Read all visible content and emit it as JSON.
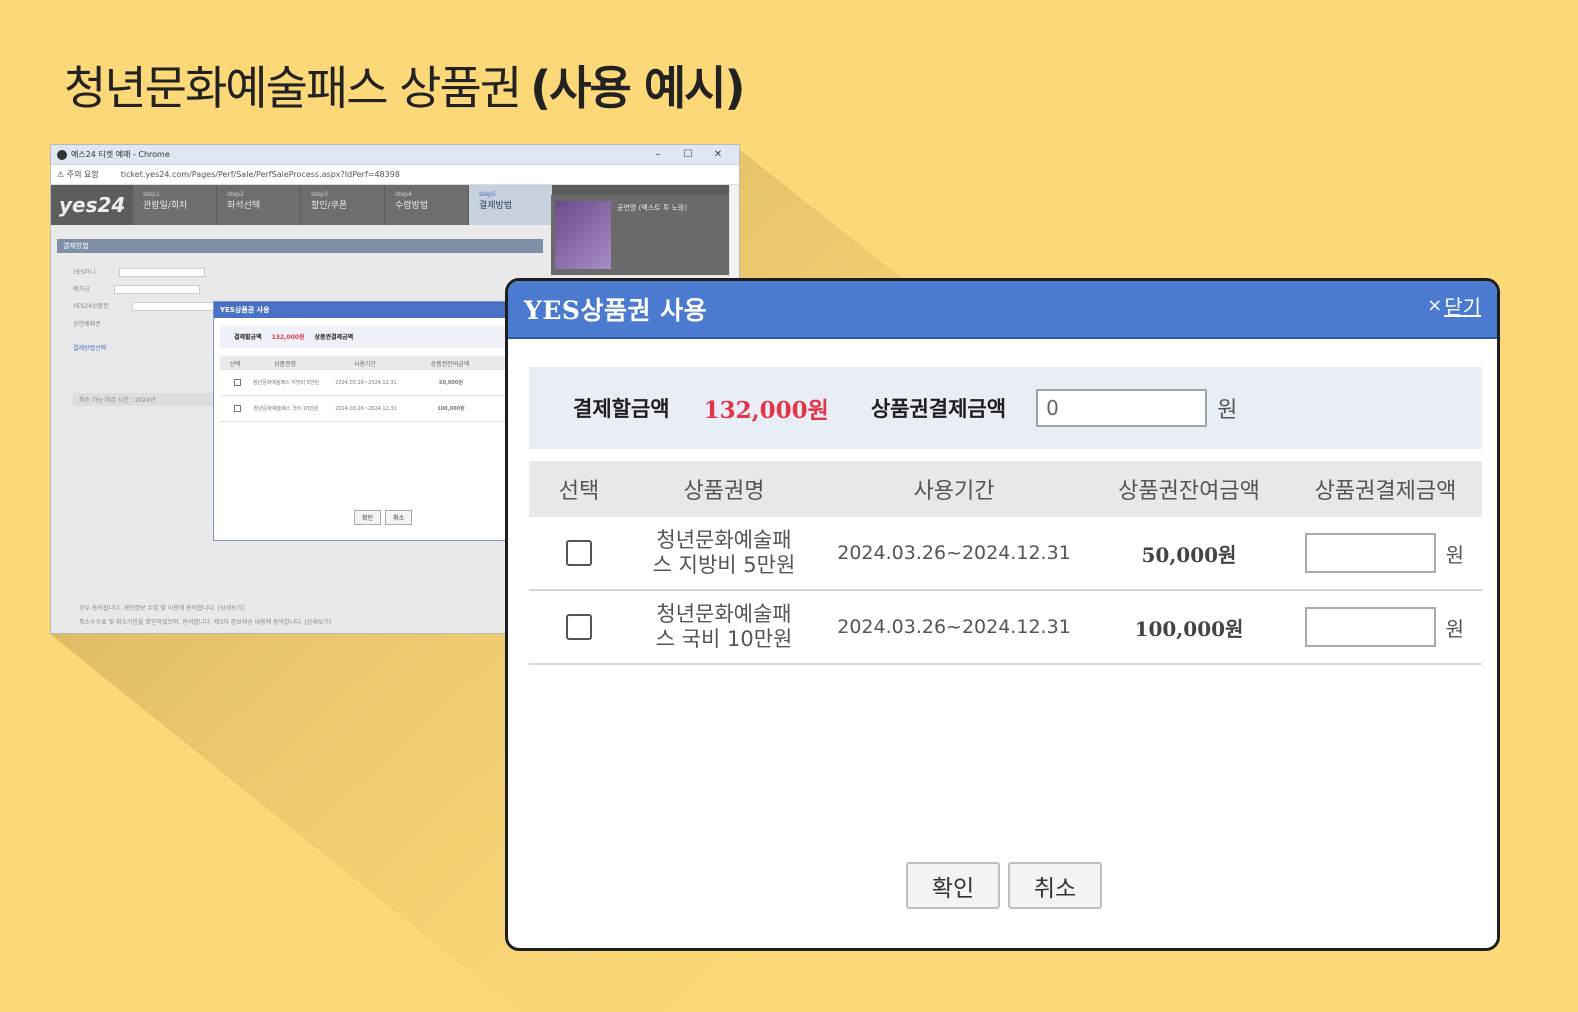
{
  "page": {
    "title_main": "청년문화예술패스 상품권",
    "title_em": "(사용 예시)"
  },
  "browser": {
    "window_title": "예스24 티켓 예매 - Chrome",
    "window_controls": [
      "–",
      "☐",
      "✕"
    ],
    "url_warning": "⚠ 주의 요함",
    "url": "ticket.yes24.com/Pages/Perf/Sale/PerfSaleProcess.aspx?IdPerf=48398",
    "logo": "yes24",
    "steps": [
      {
        "num": "step1",
        "label": "관람일/회차"
      },
      {
        "num": "step2",
        "label": "좌석선택"
      },
      {
        "num": "step3",
        "label": "할인/쿠폰"
      },
      {
        "num": "step4",
        "label": "수령방법"
      },
      {
        "num": "step5",
        "label": "결제방법"
      }
    ],
    "side_text": "공연명 (엑스트 투 노랑)",
    "section_title": "결제방법",
    "rows": [
      "YES머니",
      "예치금",
      "YES24상품권",
      "공연예매권",
      "결제방법선택"
    ],
    "cancel_notice": "취소 가능 마감 시간 : 2024년",
    "footer_1": "모두 동의합니다.   개인정보 수집 및 이용에 동의합니다. [상세보기]",
    "footer_2": "취소수수료 및 취소기한을 확인하였으며, 동의합니다.   제3자 정보제공 내용에 동의합니다. [상세보기]",
    "mini_popup": {
      "title": "YES상품권 사용",
      "sum_label": "결제할금액",
      "sum_amount": "132,000원",
      "pay_label": "상품권결제금액",
      "headers": [
        "선택",
        "상품권명",
        "사용기간",
        "상품권잔여금액"
      ],
      "rows": [
        {
          "name": "청년문화예술패스 지방비 5만원",
          "period": "2024.03.26~2024.12.31",
          "balance": "50,000원"
        },
        {
          "name": "청년문화예술패스 국비 10만원",
          "period": "2024.03.26~2024.12.31",
          "balance": "100,000원"
        }
      ],
      "ok": "확인",
      "cancel": "취소"
    }
  },
  "modal": {
    "title": "YES상품권 사용",
    "close_icon": "×",
    "close_label": "닫기",
    "summary": {
      "pay_total_label": "결제할금액",
      "pay_total_amount": "132,000원",
      "voucher_pay_label": "상품권결제금액",
      "voucher_pay_value": "0",
      "unit": "원"
    },
    "table": {
      "headers": [
        "선택",
        "상품권명",
        "사용기간",
        "상품권잔여금액",
        "상품권결제금액"
      ],
      "rows": [
        {
          "name_line1": "청년문화예술패",
          "name_line2": "스 지방비 5만원",
          "period": "2024.03.26~2024.12.31",
          "balance": "50,000원",
          "unit": "원"
        },
        {
          "name_line1": "청년문화예술패",
          "name_line2": "스 국비 10만원",
          "period": "2024.03.26~2024.12.31",
          "balance": "100,000원",
          "unit": "원"
        }
      ]
    },
    "buttons": {
      "ok": "확인",
      "cancel": "취소"
    }
  },
  "colors": {
    "background": "#FCD878",
    "header_blue": "#4a7bd0",
    "amount_red": "#e3344a"
  }
}
